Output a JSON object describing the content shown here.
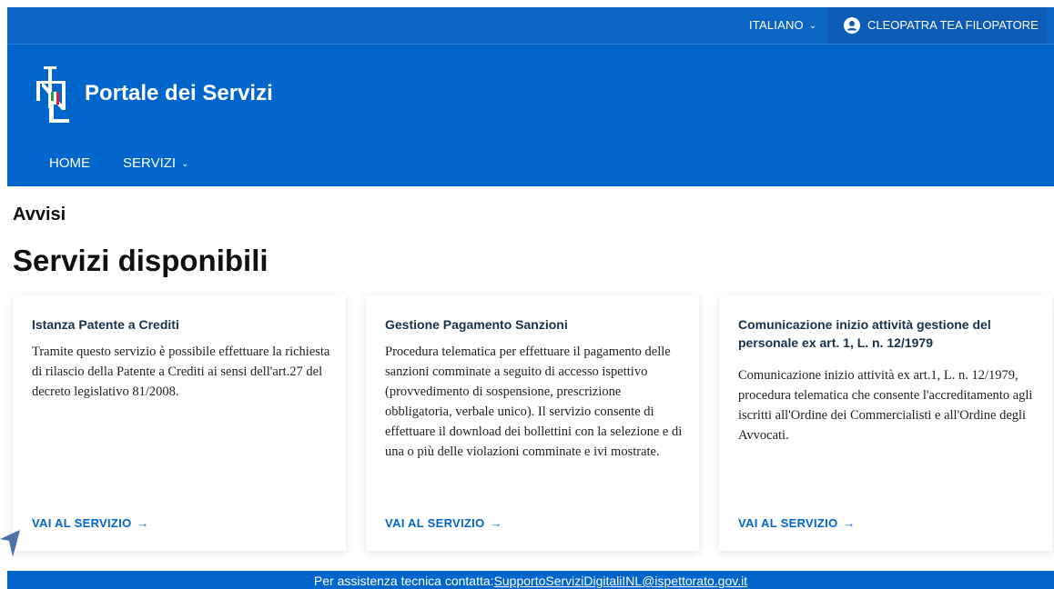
{
  "topbar": {
    "language": "ITALIANO",
    "user_name": "CLEOPATRA TEA FILOPATORE"
  },
  "header": {
    "portal_title": "Portale dei Servizi",
    "nav": {
      "home": "HOME",
      "servizi": "SERVIZI"
    }
  },
  "main": {
    "notices_title": "Avvisi",
    "section_title": "Servizi disponibili",
    "cards": [
      {
        "title": "Istanza Patente a Crediti",
        "description": "Tramite questo servizio è possibile effettuare la richiesta di rilascio della Patente a Crediti ai sensi dell'art.27 del decreto legislativo 81/2008.",
        "cta": "VAI AL SERVIZIO"
      },
      {
        "title": "Gestione Pagamento Sanzioni",
        "description": "Procedura telematica per effettuare il pagamento delle sanzioni comminate a seguito di accesso ispettivo (provvedimento di sospensione, prescrizione obbligatoria, verbale unico). Il servizio consente di effettuare il download dei bollettini con la selezione e di una o più delle violazioni comminate e ivi mostrate.",
        "cta": "VAI AL SERVIZIO"
      },
      {
        "title": "Comunicazione inizio attività gestione del personale ex art. 1, L. n. 12/1979",
        "description": "Comunicazione inizio attività ex art.1, L. n. 12/1979, procedura telematica che consente l'accreditamento agli iscritti all'Ordine dei Commercialisti e all'Ordine degli Avvocati.",
        "cta": "VAI AL SERVIZIO"
      }
    ]
  },
  "footer": {
    "text": "Per assistenza tecnica contatta:",
    "email": "SupportoServiziDigitaliINL@ispettorato.gov.it"
  },
  "colors": {
    "primary": "#0066cc",
    "topbar": "#0a66c2",
    "card_title": "#17324d"
  },
  "icons": [
    "chevron-down-icon",
    "user-circle-icon",
    "arrow-right-icon",
    "inl-logo",
    "mouse-cursor-icon"
  ]
}
